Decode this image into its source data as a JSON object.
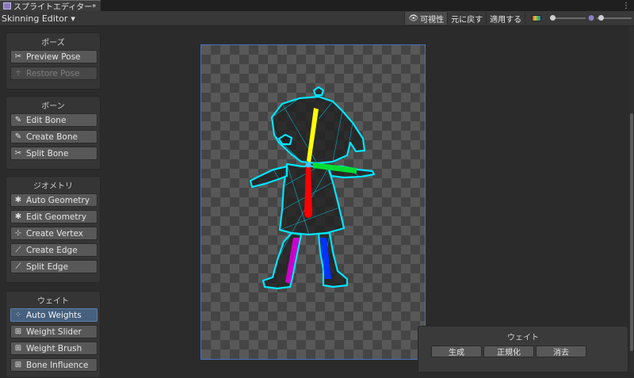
{
  "tab": {
    "title": "スプライトエディター*",
    "menu_icon": "kebab-menu-icon",
    "menu_glyph": "⋮"
  },
  "toolbar": {
    "mode": "Skinning Editor",
    "visibility_label": "可視性",
    "revert_label": "元に戻す",
    "apply_label": "適用する",
    "color_icon": "color-channels-icon"
  },
  "panels": {
    "pose": {
      "title": "ポーズ",
      "buttons": [
        {
          "label": "Preview Pose",
          "icon": "preview-pose-icon",
          "state": "normal"
        },
        {
          "label": "Restore Pose",
          "icon": "restore-pose-icon",
          "state": "disabled"
        }
      ]
    },
    "bone": {
      "title": "ボーン",
      "buttons": [
        {
          "label": "Edit Bone",
          "icon": "edit-bone-icon",
          "state": "normal"
        },
        {
          "label": "Create Bone",
          "icon": "create-bone-icon",
          "state": "normal"
        },
        {
          "label": "Split Bone",
          "icon": "split-bone-icon",
          "state": "normal"
        }
      ]
    },
    "geometry": {
      "title": "ジオメトリ",
      "buttons": [
        {
          "label": "Auto Geometry",
          "icon": "auto-geometry-icon",
          "state": "normal"
        },
        {
          "label": "Edit Geometry",
          "icon": "edit-geometry-icon",
          "state": "normal"
        },
        {
          "label": "Create Vertex",
          "icon": "create-vertex-icon",
          "state": "normal"
        },
        {
          "label": "Create Edge",
          "icon": "create-edge-icon",
          "state": "normal"
        },
        {
          "label": "Split Edge",
          "icon": "split-edge-icon",
          "state": "normal"
        }
      ]
    },
    "weight": {
      "title": "ウェイト",
      "buttons": [
        {
          "label": "Auto Weights",
          "icon": "auto-weights-icon",
          "state": "selected"
        },
        {
          "label": "Weight Slider",
          "icon": "weight-slider-icon",
          "state": "normal"
        },
        {
          "label": "Weight Brush",
          "icon": "weight-brush-icon",
          "state": "normal"
        },
        {
          "label": "Bone Influence",
          "icon": "bone-influence-icon",
          "state": "normal"
        }
      ]
    }
  },
  "weight_panel": {
    "title": "ウェイト",
    "generate_label": "生成",
    "normalize_label": "正規化",
    "clear_label": "消去"
  },
  "colors": {
    "mesh": "#00e5ff",
    "bone_head": "#ffff00",
    "bone_arm": "#00dd33",
    "bone_body": "#ff0000",
    "bone_leg_left": "#cc00cc",
    "bone_leg_right": "#0033ff",
    "selection_frame": "#4c6fbf"
  }
}
